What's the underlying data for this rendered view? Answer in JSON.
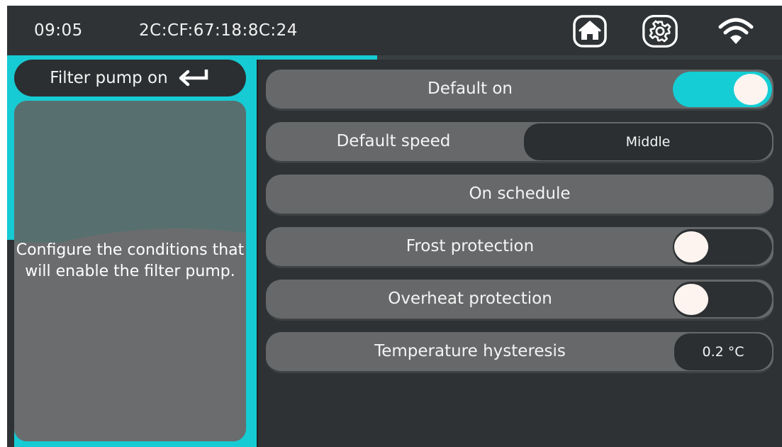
{
  "status": {
    "time": "09:05",
    "mac": "2C:CF:67:18:8C:24",
    "icons": {
      "home": "home-icon",
      "settings": "gear-icon",
      "wifi": "wifi-icon"
    }
  },
  "panel": {
    "title": "Filter pump on",
    "back_icon": "return-arrow-icon",
    "description": "Configure the conditions that will enable the filter pump."
  },
  "rows": {
    "default_on": {
      "label": "Default on",
      "state": "on"
    },
    "default_speed": {
      "label": "Default speed",
      "value": "Middle"
    },
    "on_schedule": {
      "label": "On schedule"
    },
    "frost_protection": {
      "label": "Frost protection",
      "state": "off"
    },
    "overheat_protection": {
      "label": "Overheat protection",
      "state": "off"
    },
    "temperature_hysteresis": {
      "label": "Temperature hysteresis",
      "value": "0.2 °C"
    }
  },
  "colors": {
    "accent": "#16cbd3",
    "background": "#2e3234",
    "row": "#666869",
    "pill_dark": "#2b2f31"
  }
}
